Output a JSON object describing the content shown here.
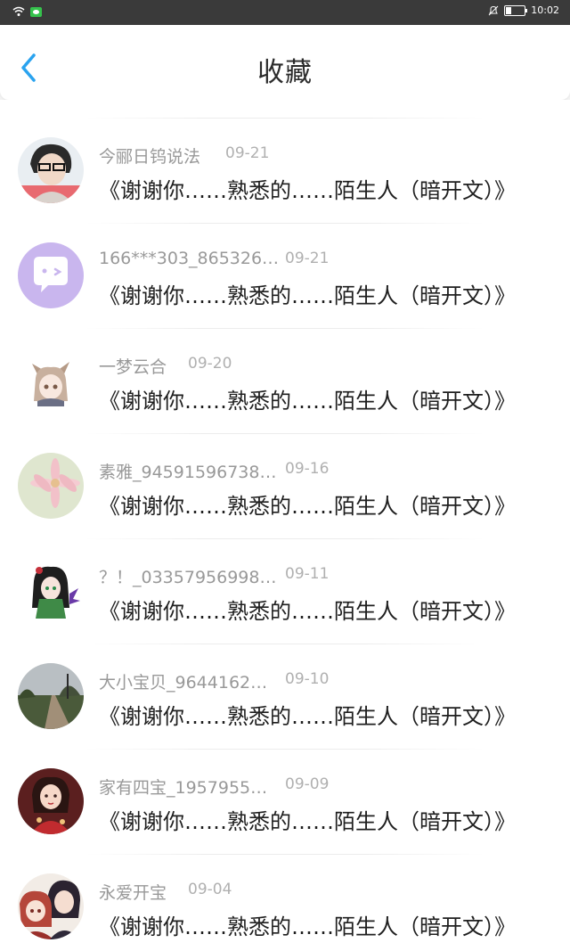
{
  "status_bar": {
    "time": "10:02",
    "icons": [
      "wifi-icon",
      "wechat-icon",
      "no-disturb-icon",
      "battery-icon"
    ]
  },
  "header": {
    "title": "收藏",
    "back_icon": "chevron-left-icon",
    "accent_color": "#2aa3ef"
  },
  "items": [
    {
      "user": "今郦日钨说法",
      "date": "09-21",
      "title": "《谢谢你……熟悉的……陌生人（暗开文）》",
      "avatar": "avatar-boy-glasses"
    },
    {
      "user": "166***303_865326…",
      "date": "09-21",
      "title": "《谢谢你……熟悉的……陌生人（暗开文）》",
      "avatar": "avatar-purple-chat"
    },
    {
      "user": "一梦云合",
      "date": "09-20",
      "title": "《谢谢你……熟悉的……陌生人（暗开文）》",
      "avatar": "avatar-anime-foxgirl"
    },
    {
      "user": "素雅_94591596738…",
      "date": "09-16",
      "title": "《谢谢你……熟悉的……陌生人（暗开文）》",
      "avatar": "avatar-pink-flower"
    },
    {
      "user": "？！_03357956998…",
      "date": "09-11",
      "title": "《谢谢你……熟悉的……陌生人（暗开文）》",
      "avatar": "avatar-anime-green"
    },
    {
      "user": "大小宝贝_9644162…",
      "date": "09-10",
      "title": "《谢谢你……熟悉的……陌生人（暗开文）》",
      "avatar": "avatar-country-road"
    },
    {
      "user": "家有四宝_1957955…",
      "date": "09-09",
      "title": "《谢谢你……熟悉的……陌生人（暗开文）》",
      "avatar": "avatar-red-dress-girl"
    },
    {
      "user": "永爱开宝",
      "date": "09-04",
      "title": "《谢谢你……熟悉的……陌生人（暗开文）》",
      "avatar": "avatar-anime-couple"
    }
  ]
}
